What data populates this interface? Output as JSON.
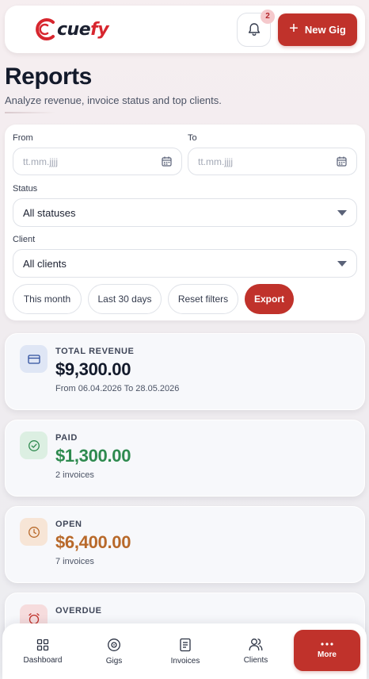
{
  "header": {
    "logo_text_dark": "cue",
    "logo_text_brand": "fy",
    "notification_count": "2",
    "new_gig_label": "New Gig"
  },
  "page": {
    "title": "Reports",
    "subtitle": "Analyze revenue, invoice status and top clients."
  },
  "filters": {
    "from_label": "From",
    "from_placeholder": "tt.mm.jjjj",
    "to_label": "To",
    "to_placeholder": "tt.mm.jjjj",
    "status_label": "Status",
    "status_value": "All statuses",
    "client_label": "Client",
    "client_value": "All clients",
    "chips": {
      "this_month": "This month",
      "last_30_days": "Last 30 days",
      "reset": "Reset filters",
      "export": "Export"
    }
  },
  "cards": {
    "total_revenue": {
      "label": "TOTAL REVENUE",
      "value": "$9,300.00",
      "note": "From 06.04.2026 To 28.05.2026",
      "icon": "card-icon"
    },
    "paid": {
      "label": "PAID",
      "value": "$1,300.00",
      "note": "2 invoices",
      "icon": "check-circle-icon"
    },
    "open": {
      "label": "OPEN",
      "value": "$6,400.00",
      "note": "7 invoices",
      "icon": "clock-icon"
    },
    "overdue": {
      "label": "OVERDUE",
      "icon": "alarm-icon"
    }
  },
  "nav": {
    "dashboard": "Dashboard",
    "gigs": "Gigs",
    "invoices": "Invoices",
    "clients": "Clients",
    "more": "More"
  },
  "colors": {
    "brand": "#c0322b",
    "paid": "#2e8a4f",
    "open": "#b8692a",
    "total": "#131a2b"
  }
}
